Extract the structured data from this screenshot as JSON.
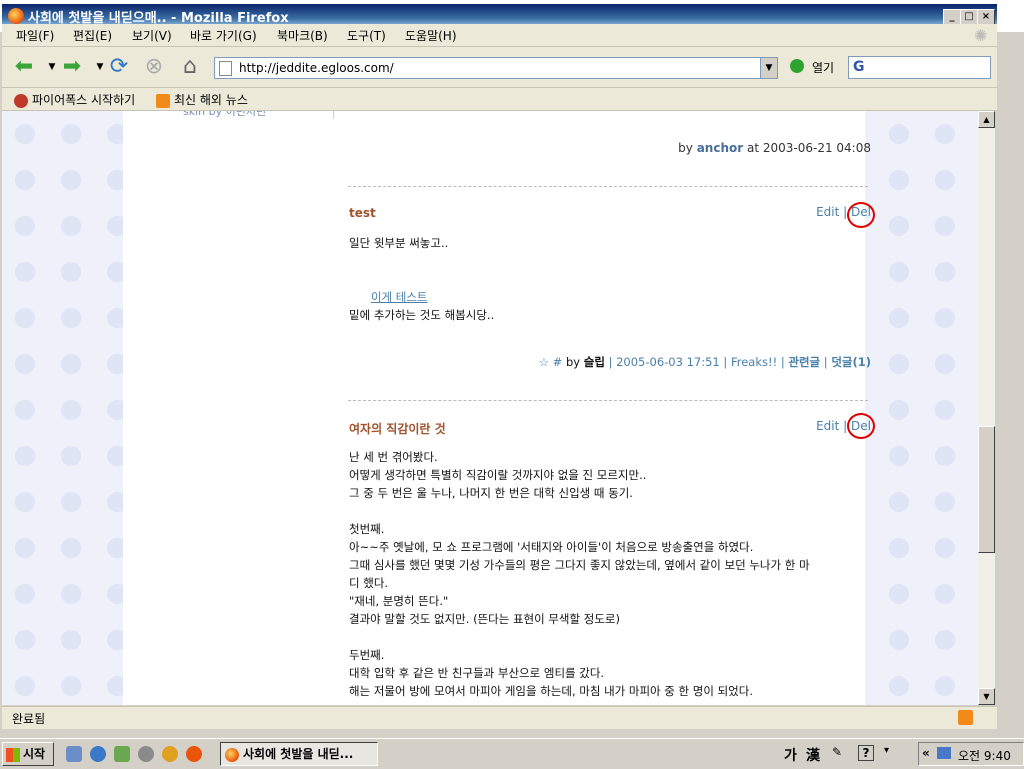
{
  "window": {
    "title": "사회에 첫발을 내딛으매.. - Mozilla Firefox"
  },
  "menu": [
    "파일(F)",
    "편집(E)",
    "보기(V)",
    "바로 가기(G)",
    "북마크(B)",
    "도구(T)",
    "도움말(H)"
  ],
  "nav": {
    "url": "http://jeddite.egloos.com/",
    "go_label": "열기"
  },
  "bookmarks": [
    "파이어폭스 시작하기",
    "최신 해외 뉴스"
  ],
  "page": {
    "sidebar_tail": "skin by 이런저런",
    "prev_byline": {
      "by": "by",
      "author": "anchor",
      "at": "at 2003-06-21 04:08"
    },
    "post1": {
      "title": "test",
      "edit": "Edit",
      "sep": "|",
      "del": "Del",
      "line1": "일단 윗부분 써놓고..",
      "link": "이게 테스트",
      "line2": "밑에 추가하는 것도 해봅시당..",
      "meta": {
        "star": "☆ #",
        "by": "by",
        "author": "슬립",
        "sep1": "|",
        "date": "2005-06-03 17:51",
        "sep2": "|",
        "category": "Freaks!!",
        "sep3": "|",
        "related": "관련글",
        "sep4": "|",
        "comments": "덧글(1)"
      }
    },
    "post2": {
      "title": "여자의 직감이란 것",
      "edit": "Edit",
      "sep": "|",
      "del": "Del",
      "body": "난 세 번 겪어봤다.\n어떻게 생각하면 특별히 직감이랄 것까지야 없을 진 모르지만..\n그 중 두 번은 울 누나, 나머지 한 번은 대학 신입생 때 동기.\n\n첫번째.\n아~~주 옛날에, 모 쇼 프로그램에 '서태지와 아이들'이 처음으로 방송출연을 하였다.\n그때 심사를 했던 몇몇 기성 가수들의 평은 그다지 좋지 않았는데, 옆에서 같이 보던 누나가 한 마\n디 했다.\n\"재네, 분명히 뜬다.\"\n결과야 말할 것도 없지만. (뜬다는 표현이 무색할 정도로)\n\n두번째.\n대학 입학 후 같은 반 친구들과 부산으로 엠티를 갔다.\n해는 저물어 방에 모여서 마피아 게임을 하는데, 마침 내가 마피아 중 한 명이 되었다."
    }
  },
  "status": {
    "text": "완료됨"
  },
  "taskbar": {
    "start": "시작",
    "task": "사회에 첫발을 내딛...",
    "ime_lang": "가",
    "ime_han": "漢",
    "clock": "오전 9:40"
  }
}
